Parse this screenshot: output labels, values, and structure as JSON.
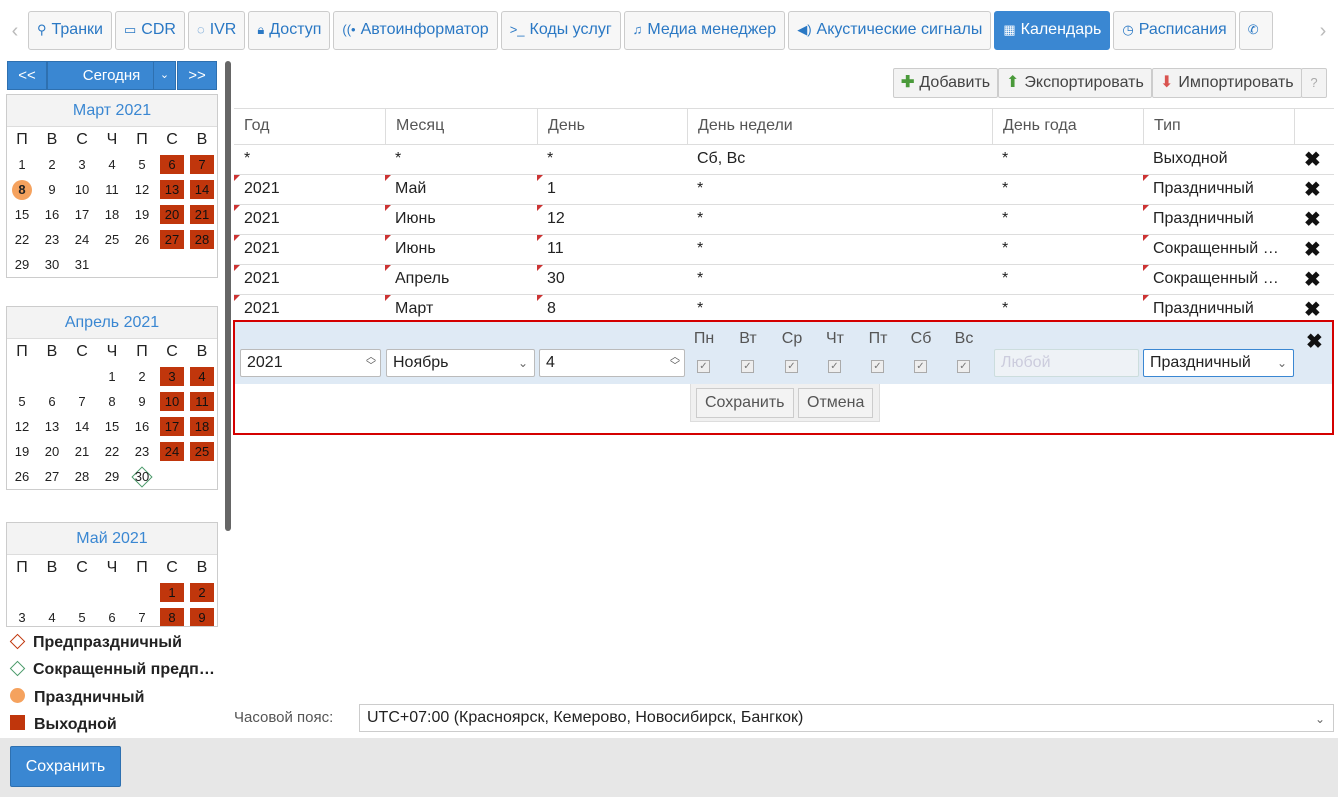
{
  "tabs": [
    {
      "label": "Транки",
      "icon": "trunk-icon"
    },
    {
      "label": "CDR",
      "icon": "card-icon"
    },
    {
      "label": "IVR",
      "icon": "chat-icon"
    },
    {
      "label": "Доступ",
      "icon": "lock-icon"
    },
    {
      "label": "Автоинформатор",
      "icon": "broadcast-icon"
    },
    {
      "label": "Коды услуг",
      "icon": "terminal-icon"
    },
    {
      "label": "Медиа менеджер",
      "icon": "music-icon"
    },
    {
      "label": "Акустические сигналы",
      "icon": "speaker-icon"
    },
    {
      "label": "Календарь",
      "icon": "calendar-icon",
      "active": true
    },
    {
      "label": "Расписания",
      "icon": "clock-icon"
    },
    {
      "label": "",
      "icon": "phone-icon"
    }
  ],
  "calnav": {
    "prev": "<<",
    "today": "Сегодня",
    "next": ">>"
  },
  "weekdays": [
    "П",
    "В",
    "С",
    "Ч",
    "П",
    "С",
    "В"
  ],
  "months": [
    {
      "title": "Март 2021",
      "offset": 0,
      "days": 31,
      "red": [
        6,
        7,
        13,
        14,
        20,
        21,
        27,
        28
      ],
      "holiday": [
        8
      ],
      "short": []
    },
    {
      "title": "Апрель 2021",
      "offset": 3,
      "days": 30,
      "red": [
        3,
        4,
        10,
        11,
        17,
        18,
        24,
        25
      ],
      "holiday": [],
      "short": [
        30
      ]
    },
    {
      "title": "Май 2021",
      "offset": 5,
      "days": 9,
      "red": [
        1,
        2,
        8,
        9
      ],
      "holiday": [],
      "short": []
    }
  ],
  "legend": {
    "pre": "Предпраздничный",
    "short": "Сокращенный предп…",
    "holiday": "Праздничный",
    "weekend": "Выходной"
  },
  "toolbar": {
    "add": "Добавить",
    "export": "Экспортировать",
    "import": "Импортировать",
    "help": "?"
  },
  "columns": [
    "Год",
    "Месяц",
    "День",
    "День недели",
    "День года",
    "Тип"
  ],
  "rows": [
    {
      "year": "*",
      "month": "*",
      "day": "*",
      "weekday": "Сб, Вс",
      "yearday": "*",
      "type": "Выходной",
      "marked": false
    },
    {
      "year": "2021",
      "month": "Май",
      "day": "1",
      "weekday": "*",
      "yearday": "*",
      "type": "Праздничный",
      "marked": true
    },
    {
      "year": "2021",
      "month": "Июнь",
      "day": "12",
      "weekday": "*",
      "yearday": "*",
      "type": "Праздничный",
      "marked": true
    },
    {
      "year": "2021",
      "month": "Июнь",
      "day": "11",
      "weekday": "*",
      "yearday": "*",
      "type": "Сокращенный …",
      "marked": true
    },
    {
      "year": "2021",
      "month": "Апрель",
      "day": "30",
      "weekday": "*",
      "yearday": "*",
      "type": "Сокращенный …",
      "marked": true
    },
    {
      "year": "2021",
      "month": "Март",
      "day": "8",
      "weekday": "*",
      "yearday": "*",
      "type": "Праздничный",
      "marked": true
    }
  ],
  "edit": {
    "year": "2021",
    "month": "Ноябрь",
    "day": "4",
    "weekdays": [
      "Пн",
      "Вт",
      "Ср",
      "Чт",
      "Пт",
      "Сб",
      "Вс"
    ],
    "yearday_placeholder": "Любой",
    "type": "Праздничный",
    "save": "Сохранить",
    "cancel": "Отмена"
  },
  "timezone": {
    "label": "Часовой пояс:",
    "value": "UTC+07:00 (Красноярск, Кемерово, Новосибирск, Бангкок)"
  },
  "footer": {
    "save": "Сохранить"
  }
}
